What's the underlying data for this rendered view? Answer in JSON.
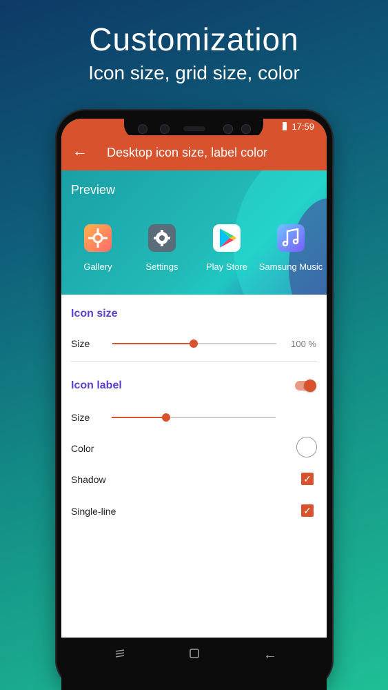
{
  "promo": {
    "title": "Customization",
    "subtitle": "Icon size, grid size, color"
  },
  "status": {
    "time": "17:59"
  },
  "toolbar": {
    "title": "Desktop icon size, label color"
  },
  "preview": {
    "label": "Preview",
    "apps": [
      {
        "name": "Gallery",
        "icon": "gallery-icon"
      },
      {
        "name": "Settings",
        "icon": "settings-icon"
      },
      {
        "name": "Play Store",
        "icon": "play-store-icon"
      },
      {
        "name": "Samsung Music",
        "icon": "samsung-music-icon"
      }
    ]
  },
  "icon_size": {
    "title": "Icon size",
    "size_label": "Size",
    "value_text": "100 %",
    "slider_fraction": 0.5
  },
  "icon_label": {
    "title": "Icon label",
    "enabled": true,
    "size_label": "Size",
    "size_fraction": 0.33,
    "color_label": "Color",
    "color_value": "#ffffff",
    "shadow_label": "Shadow",
    "shadow_checked": true,
    "single_line_label": "Single-line",
    "single_line_checked": true
  },
  "colors": {
    "accent": "#d9522e",
    "section": "#5e3fd0"
  },
  "navigation": {
    "icons": [
      "recents-icon",
      "home-icon",
      "back-icon"
    ]
  }
}
